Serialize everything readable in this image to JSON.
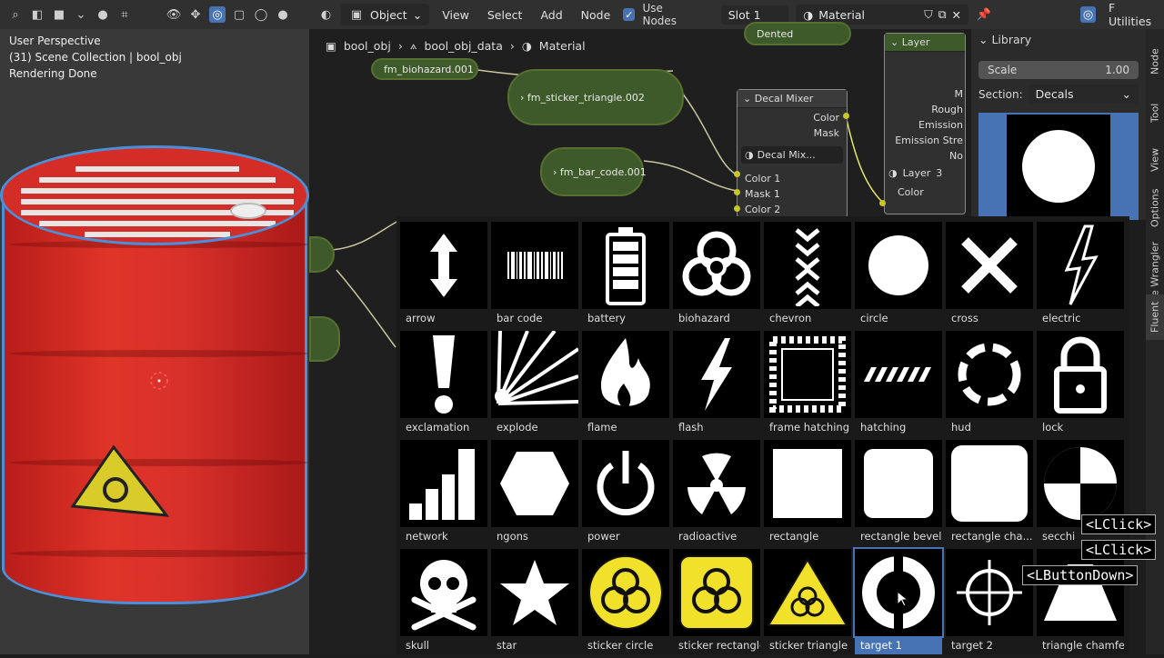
{
  "viewport": {
    "overlay_lines": [
      "User Perspective",
      "(31) Scene Collection | bool_obj",
      "Rendering Done"
    ]
  },
  "node_header": {
    "mode": "Object",
    "menus": [
      "View",
      "Select",
      "Add",
      "Node"
    ],
    "use_nodes_label": "Use Nodes",
    "slot": "Slot 1",
    "material": "Material",
    "utilities": "F Utilities"
  },
  "breadcrumb": [
    "bool_obj",
    "bool_obj_data",
    "Material"
  ],
  "nodes": {
    "dented": "Dented",
    "biohazard": "fm_biohazard.001",
    "sticker_triangle": "fm_sticker_triangle.002",
    "bar_code": "fm_bar_code.001",
    "decal_mixer": {
      "title": "Decal Mixer",
      "outputs": [
        "Color",
        "Mask"
      ],
      "group_name": "Decal Mix...",
      "inputs": [
        "Color 1",
        "Mask 1",
        "Color 2"
      ]
    },
    "layer": {
      "title": "Layer",
      "rows": [
        "M",
        "Rough",
        "Emission",
        "Emission Stre",
        "No"
      ],
      "layer_label": "Layer",
      "layer_value": "3",
      "output": "Color"
    }
  },
  "sidebar": {
    "panel_title": "Library",
    "scale_label": "Scale",
    "scale_value": "1.00",
    "section_label": "Section:",
    "section_value": "Decals"
  },
  "tabs": [
    "Node",
    "Tool",
    "View",
    "Options",
    "Node Wrangler",
    "Fluent"
  ],
  "library_items": [
    "arrow",
    "bar code",
    "battery",
    "biohazard",
    "chevron",
    "circle",
    "cross",
    "electric",
    "exclamation",
    "explode",
    "flame",
    "flash",
    "frame hatching",
    "hatching",
    "hud",
    "lock",
    "network",
    "ngons",
    "power",
    "radioactive",
    "rectangle",
    "rectangle bevel",
    "rectangle cha...",
    "secchi",
    "skull",
    "star",
    "sticker circle",
    "sticker rectangle",
    "sticker triangle",
    "target 1",
    "target 2",
    "triangle chamfer"
  ],
  "selected_item": "target 1",
  "key_overlays": [
    "<LClick>",
    "<LClick>",
    "<LButtonDown>"
  ],
  "colors": {
    "accent": "#4772b3",
    "node_green": "#3e5a2a",
    "barrel_red": "#d42d27",
    "sticker_yellow": "#f2e12a"
  }
}
